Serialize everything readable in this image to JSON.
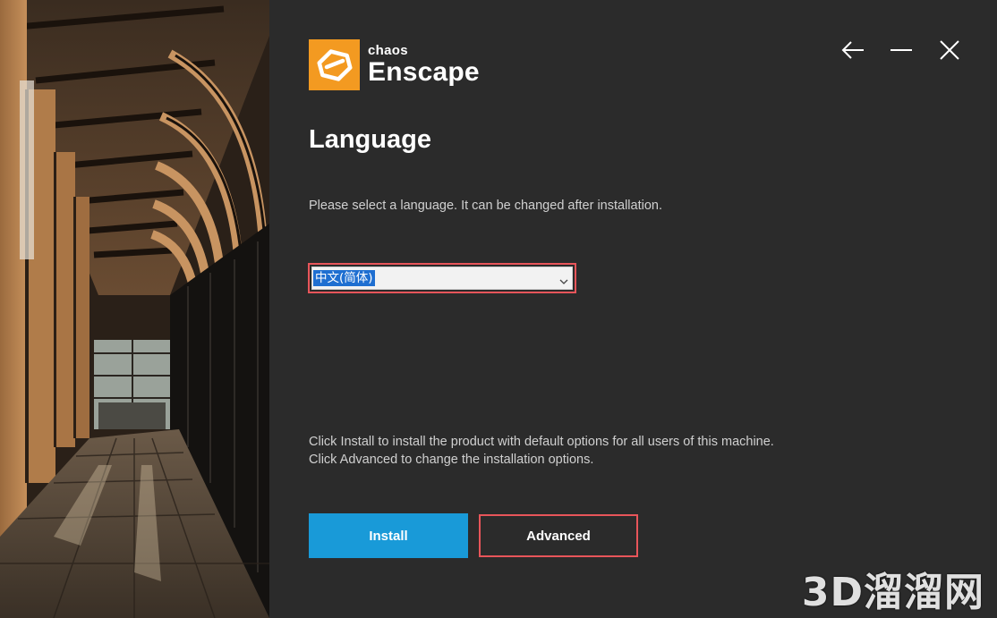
{
  "header": {
    "brand": "chaos",
    "product": "Enscape",
    "controls": [
      "back-arrow-icon",
      "minimize-icon",
      "close-icon"
    ]
  },
  "page": {
    "title": "Language",
    "description": "Please select a language. It can be changed after installation."
  },
  "language_select": {
    "selected": "中文(简体)"
  },
  "info": {
    "line1": "Click Install to install the product with default options for all users of this machine.",
    "line2": "Click Advanced to change the installation options."
  },
  "buttons": {
    "install": "Install",
    "advanced": "Advanced"
  },
  "watermark": "3D溜溜网",
  "colors": {
    "background": "#2b2b2b",
    "logo_orange": "#f39a21",
    "install_blue": "#199ad8",
    "highlight_red": "#e8555a",
    "selection_blue": "#1f6fd1"
  }
}
